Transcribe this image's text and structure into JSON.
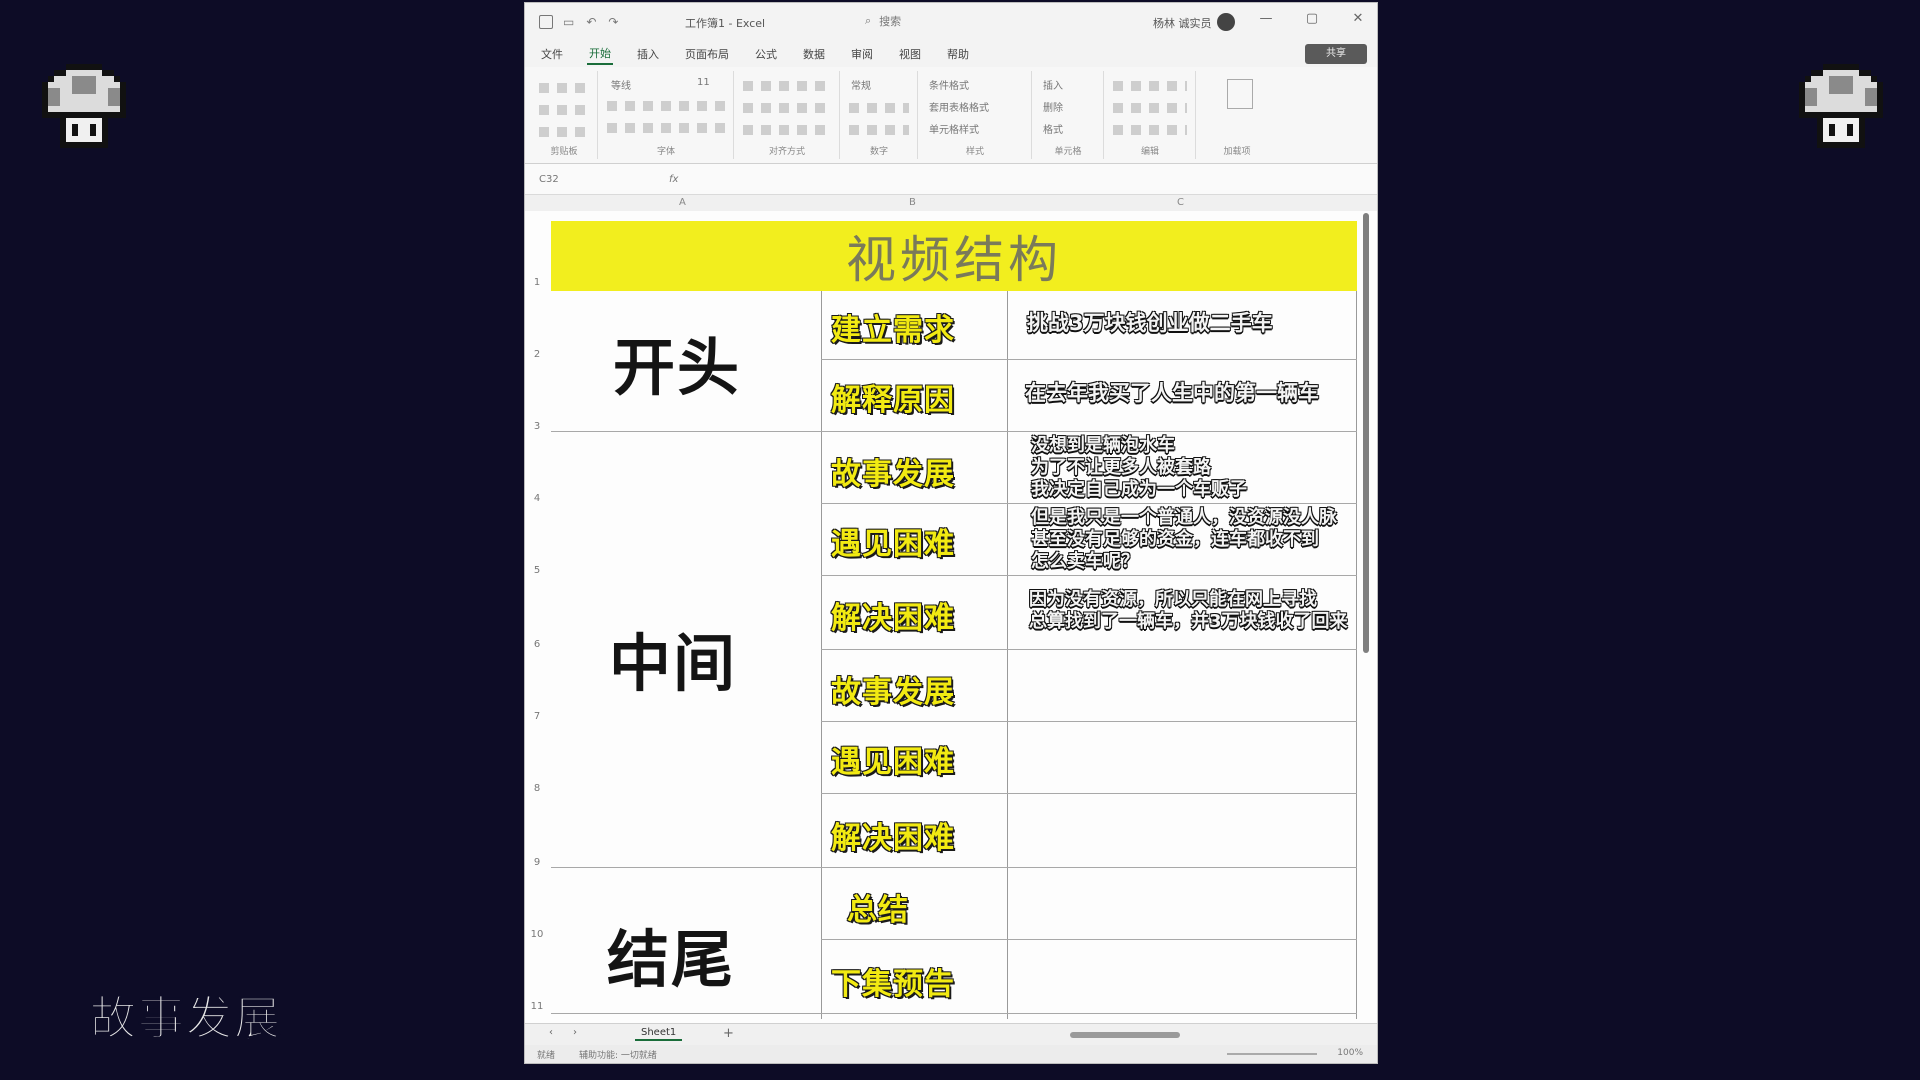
{
  "window": {
    "doc_title": "工作簿1 - Excel",
    "search_placeholder": "搜索",
    "user_name": "杨林 诚实员",
    "minimize": "—",
    "maximize": "▢",
    "close": "✕"
  },
  "menu": {
    "items": [
      "文件",
      "开始",
      "插入",
      "页面布局",
      "公式",
      "数据",
      "审阅",
      "视图",
      "帮助"
    ],
    "active_index": 1,
    "share_label": "共享"
  },
  "ribbon": {
    "groups": [
      "剪贴板",
      "字体",
      "对齐方式",
      "数字",
      "样式",
      "单元格",
      "编辑",
      "加载项"
    ],
    "font_name": "等线",
    "font_size": "11",
    "number_format": "常规",
    "style_items": [
      "条件格式",
      "套用表格格式",
      "单元格样式"
    ],
    "cell_items": [
      "插入",
      "删除",
      "格式"
    ]
  },
  "formula_bar": {
    "name_box": "C32",
    "fx": "fx"
  },
  "columns": [
    "A",
    "B",
    "C"
  ],
  "rows": [
    "1",
    "2",
    "3",
    "4",
    "5",
    "6",
    "7",
    "8",
    "9",
    "10",
    "11"
  ],
  "sheet": {
    "banner": "视频结构",
    "sections": {
      "start": "开头",
      "middle": "中间",
      "end": "结尾"
    },
    "steps": [
      "建立需求",
      "解释原因",
      "故事发展",
      "遇见困难",
      "解决困难",
      "故事发展",
      "遇见困难",
      "解决困难",
      "总结",
      "下集预告"
    ],
    "notes": {
      "n1": "挑战3万块钱创业做二手车",
      "n2": "在去年我买了人生中的第一辆车",
      "n3a": "没想到是辆泡水车",
      "n3b": "为了不让更多人被套路",
      "n3c": "我决定自己成为一个车贩子",
      "n4a": "但是我只是一个普通人，没资源没人脉",
      "n4b": "甚至没有足够的资金，连车都收不到",
      "n4c": "怎么卖车呢？",
      "n5a": "因为没有资源，所以只能在网上寻找",
      "n5b": "总算找到了一辆车，并3万块钱收了回来"
    }
  },
  "tabs": {
    "sheet_name": "Sheet1",
    "add": "+"
  },
  "status": {
    "ready": "就绪",
    "accessibility": "辅助功能: 一切就绪",
    "zoom": "100%"
  },
  "caption": "故事发展",
  "colors": {
    "background": "#0d0c26",
    "banner": "#f2ee1e",
    "step_text": "#f2ea12",
    "excel_green": "#1a6d3a"
  }
}
